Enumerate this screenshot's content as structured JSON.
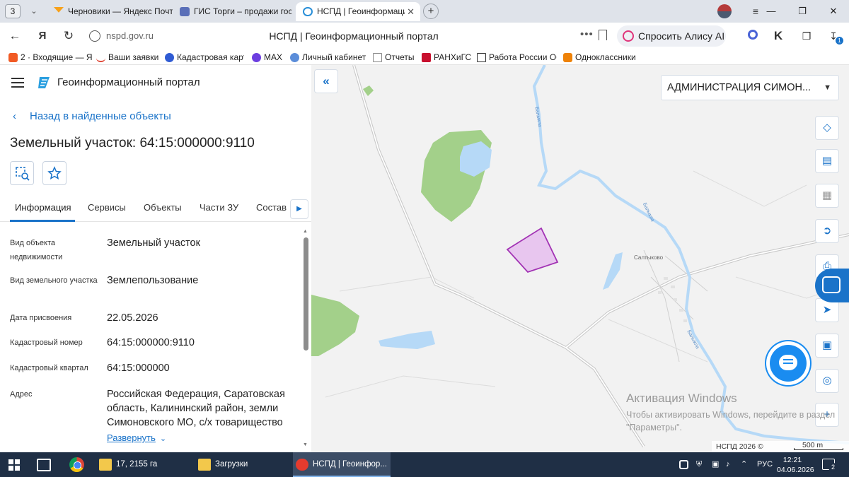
{
  "browser": {
    "tab_count": "3",
    "tabs": [
      {
        "title": "Черновики — Яндекс Почта"
      },
      {
        "title": "ГИС Торги – продажи государственного"
      },
      {
        "title": "НСПД | Геоинформационный портал"
      }
    ],
    "url": "nspd.gov.ru",
    "page_title": "НСПД | Геоинформационный портал",
    "alice_label": "Спросить Алису AI",
    "downloads_badge": "1",
    "bookmarks": [
      {
        "label": "2 · Входящие — Я",
        "color": "#f15a24"
      },
      {
        "label": "Ваши заявки",
        "color": "#ffffff"
      },
      {
        "label": "Кадастровая карт",
        "color": "#2f5bd3"
      },
      {
        "label": "MAX",
        "color": "#6c3ee0"
      },
      {
        "label": "Личный кабинет",
        "color": "#5b8dd9"
      },
      {
        "label": "Отчеты",
        "color": "#888888"
      },
      {
        "label": "РАНХиГС",
        "color": "#c8102e"
      },
      {
        "label": "Работа России Об",
        "color": "#333333"
      },
      {
        "label": "Одноклассники",
        "color": "#ee8208"
      }
    ]
  },
  "panel": {
    "portal_name": "Геоинформационный портал",
    "back_link": "Назад в найденные объекты",
    "title": "Земельный участок: 64:15:000000:9110",
    "tabs": [
      "Информация",
      "Сервисы",
      "Объекты",
      "Части ЗУ",
      "Состав"
    ],
    "properties": [
      {
        "label": "Вид объекта недвижимости",
        "value": "Земельный участок"
      },
      {
        "label": "Вид земельного участка",
        "value": "Землепользование"
      },
      {
        "label": "Дата присвоения",
        "value": "22.05.2026"
      },
      {
        "label": "Кадастровый номер",
        "value": "64:15:000000:9110"
      },
      {
        "label": "Кадастровый квартал",
        "value": "64:15:000000"
      },
      {
        "label": "Адрес",
        "value": "Российская Федерация, Саратовская область, Калининский район, земли Симоновского МО, с/х товарищество"
      }
    ],
    "expand_link": "Развернуть"
  },
  "map": {
    "admin_select": "АДМИНИСТРАЦИЯ СИМОН...",
    "place_label": "Салтыково",
    "river_label": "Балыкла",
    "footer_copyright": "НСПД 2026 ©",
    "scale_label": "500 m",
    "watermark_title": "Активация Windows",
    "watermark_text": "Чтобы активировать Windows, перейдите в раздел \"Параметры\".",
    "colors": {
      "parcel_fill": "#e8c6ef",
      "parcel_stroke": "#a233b4",
      "forest": "#a3d08a",
      "water": "#b6d9f7"
    }
  },
  "taskbar": {
    "apps": [
      {
        "label": "17, 2155 га"
      },
      {
        "label": "Загрузки"
      },
      {
        "label": "НСПД | Геоинфор..."
      }
    ],
    "lang": "РУС",
    "time": "12:21",
    "date": "04.06.2026",
    "notifications": "2"
  }
}
